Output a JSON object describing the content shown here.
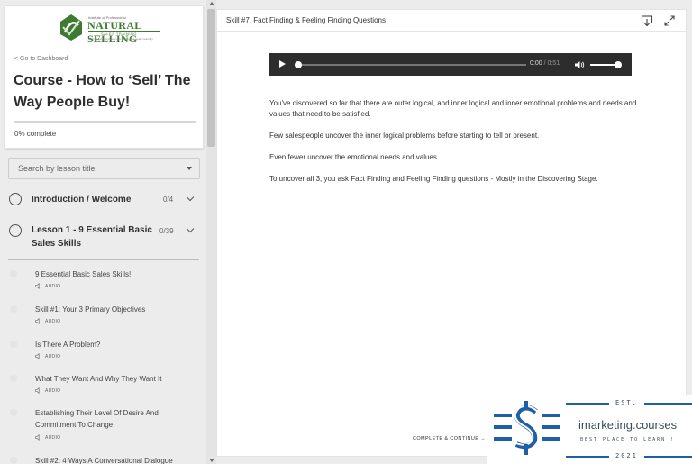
{
  "brand": {
    "logo_small": "Institute of Professional",
    "logo_text": "NATURAL SELLING",
    "logo_sub": "SALES TRAINING",
    "logo_tag": "Helping sales professionals reach their goals naturally"
  },
  "sidebar": {
    "back_link": "< Go to Dashboard",
    "course_title": "Course - How to ‘Sell’ The Way People Buy!",
    "progress_label": "0% complete",
    "progress_fraction": 0.0,
    "search_placeholder": "Search by lesson title",
    "sections": [
      {
        "name": "Introduction / Welcome",
        "count": "0/4"
      },
      {
        "name": "Lesson 1 - 9 Essential Basic Sales Skills",
        "count": "0/39"
      }
    ],
    "lessons": [
      {
        "name": "9 Essential Basic Sales Skills!",
        "type": "AUDIO"
      },
      {
        "name": "Skill #1: Your 3 Primary Objectives",
        "type": "AUDIO"
      },
      {
        "name": "Is There A Problem?",
        "type": "AUDIO"
      },
      {
        "name": "What They Want And Why They Want It",
        "type": "AUDIO"
      },
      {
        "name": "Establishing Their Level Of Desire And Commitment To Change",
        "type": "AUDIO"
      },
      {
        "name": "Skill #2: 4 Ways A Conversational Dialogue",
        "type": ""
      }
    ]
  },
  "main": {
    "lesson_title": "Skill #7. Fact Finding & Feeling Finding Questions",
    "player": {
      "current": "0:00",
      "separator": " / ",
      "duration": "0:51"
    },
    "paragraphs": [
      "You've discovered so far that there are outer logical, and inner logical and inner emotional problems and needs and values that need to be satisfied.",
      "Few salespeople uncover the inner logical problems before starting to tell or present.",
      "Even fewer uncover the emotional needs and values.",
      "To uncover all 3, you ask Fact Finding and Feeling Finding questions - Mostly in the Discovering Stage."
    ],
    "complete_button": "COMPLETE & CONTINUE →"
  },
  "watermark": {
    "est": "EST.",
    "name": "imarketing.courses",
    "tagline": "BEST PLACE TO LEARN !",
    "year": "2021"
  },
  "colors": {
    "brand_green": "#3f7a33",
    "watermark_blue": "#1f5fa8",
    "player_bg": "#2d2d2d"
  },
  "icons": [
    "play-icon",
    "volume-icon",
    "download-icon",
    "expand-icon",
    "audio-icon",
    "chevron-down-icon"
  ]
}
